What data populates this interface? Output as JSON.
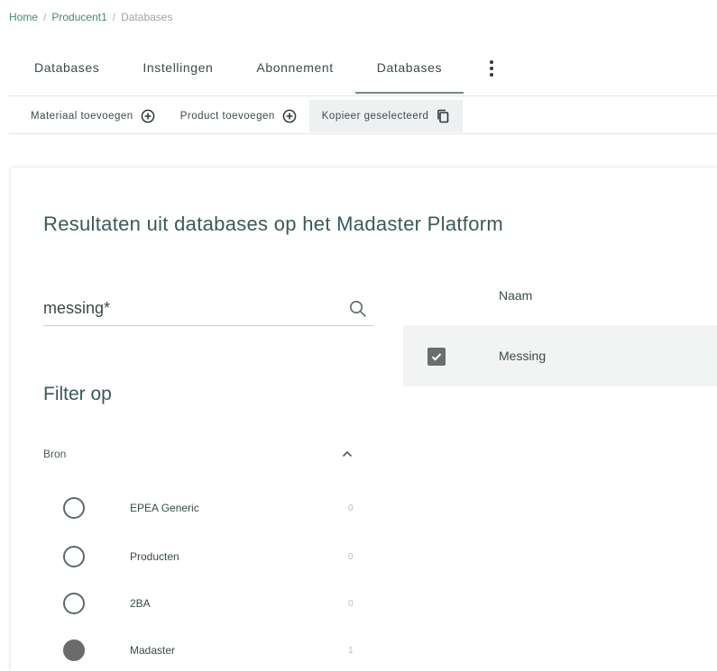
{
  "breadcrumb": {
    "home": "Home",
    "producent": "Producent1",
    "current": "Databases",
    "separator": "/"
  },
  "tabs": [
    {
      "label": "Databases"
    },
    {
      "label": "Instellingen"
    },
    {
      "label": "Abonnement"
    },
    {
      "label": "Databases"
    }
  ],
  "toolbar": {
    "add_material": "Materiaal toevoegen",
    "add_product": "Product toevoegen",
    "copy_selected": "Kopieer geselecteerd"
  },
  "heading": "Resultaten uit databases op het Madaster Platform",
  "search": {
    "value": "messing*"
  },
  "filter": {
    "title": "Filter op",
    "group": "Bron",
    "sources": [
      {
        "label": "EPEA Generic",
        "count": "0",
        "selected": false
      },
      {
        "label": "Producten",
        "count": "0",
        "selected": false
      },
      {
        "label": "2BA",
        "count": "0",
        "selected": false
      },
      {
        "label": "Madaster",
        "count": "1",
        "selected": true
      }
    ]
  },
  "results": {
    "column_name": "Naam",
    "rows": [
      {
        "name": "Messing",
        "checked": true
      }
    ]
  },
  "colors": {
    "accent": "#3d8a6a",
    "text": "#3b4a4a",
    "heading": "#3a5a5a",
    "row_bg": "#f2f4f4"
  }
}
